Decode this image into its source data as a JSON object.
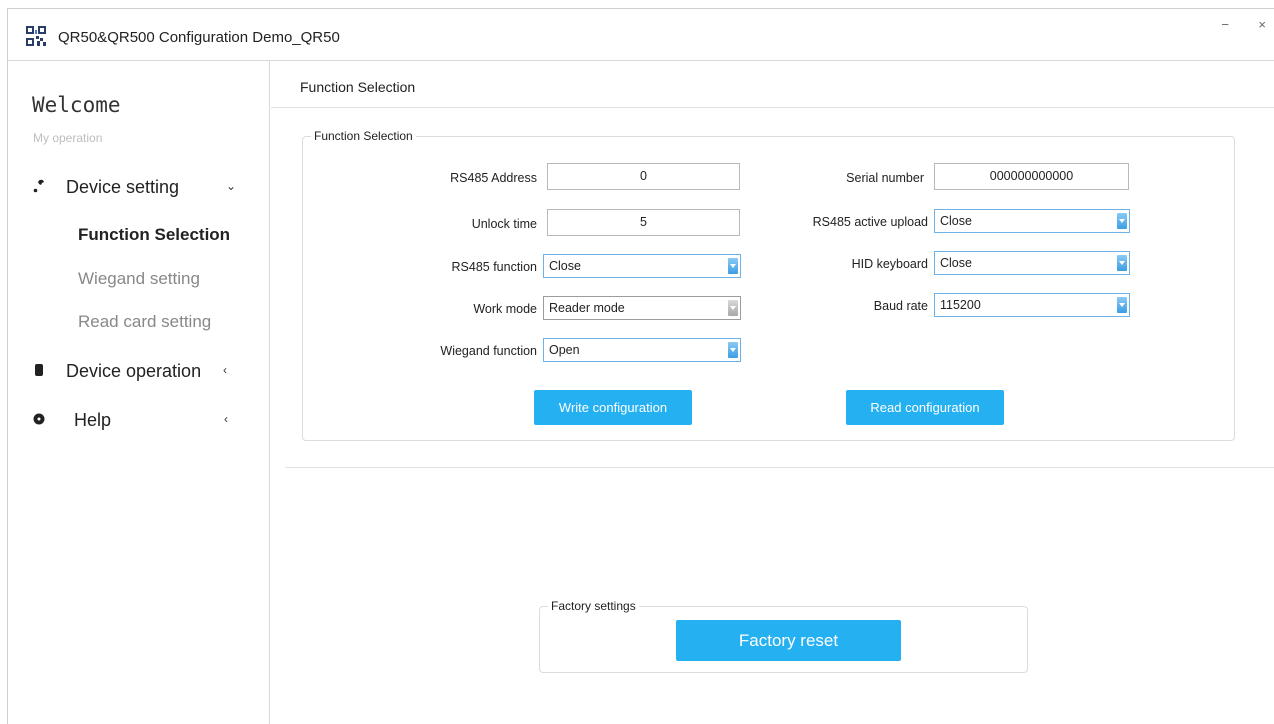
{
  "window": {
    "title": "QR50&QR500 Configuration Demo_QR50",
    "minimize": "−",
    "close": "×"
  },
  "sidebar": {
    "welcome": "Welcome",
    "section": "My operation",
    "device_setting": "Device setting",
    "device_setting_caret": "⌄",
    "subitems": [
      "Function Selection",
      "Wiegand setting",
      "Read card setting"
    ],
    "device_operation": "Device operation",
    "device_operation_caret": "‹",
    "help": "Help",
    "help_caret": "‹"
  },
  "main": {
    "title": "Function Selection",
    "group_title": "Function Selection",
    "fields": {
      "rs485_address": {
        "label": "RS485 Address",
        "value": "0"
      },
      "unlock_time": {
        "label": "Unlock time",
        "value": "5"
      },
      "rs485_function": {
        "label": "RS485 function",
        "value": "Close"
      },
      "work_mode": {
        "label": "Work mode",
        "value": "Reader mode"
      },
      "wiegand_function": {
        "label": "Wiegand function",
        "value": "Open"
      },
      "serial_number": {
        "label": "Serial number",
        "value": "000000000000"
      },
      "rs485_active_upload": {
        "label": "RS485 active upload",
        "value": "Close"
      },
      "hid_keyboard": {
        "label": "HID keyboard",
        "value": "Close"
      },
      "baud_rate": {
        "label": "Baud rate",
        "value": "115200"
      }
    },
    "write_button": "Write configuration",
    "read_button": "Read configuration",
    "factory_group": "Factory settings",
    "factory_reset_button": "Factory reset"
  },
  "colors": {
    "accent": "#25b0f2",
    "select_border": "#6fb2e8"
  }
}
